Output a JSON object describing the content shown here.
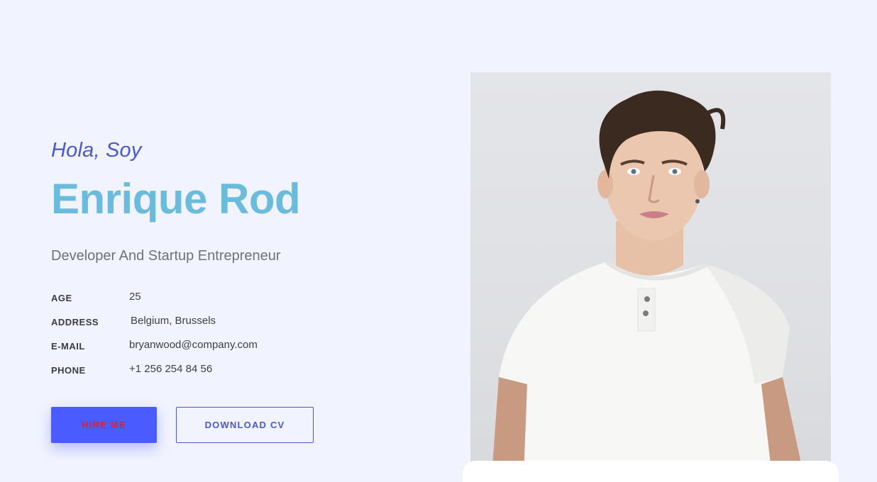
{
  "hero": {
    "greeting": "Hola, Soy",
    "name": "Enrique Rod",
    "subtitle": "Developer And Startup Entrepreneur",
    "info": [
      {
        "label": "AGE",
        "value": "25"
      },
      {
        "label": "ADDRESS",
        "value": "Belgium, Brussels"
      },
      {
        "label": "E-MAIL",
        "value": "bryanwood@company.com"
      },
      {
        "label": "PHONE",
        "value": "+1 256 254 84 56"
      }
    ],
    "buttons": {
      "hire": "HIRE ME",
      "cv": "DOWNLOAD CV"
    }
  },
  "colors": {
    "background": "#f1f3fe",
    "accent": "#4a5cff",
    "name": "#6bbcdc",
    "greeting": "#4a59c8"
  },
  "image": {
    "subject": "portrait-photo"
  }
}
